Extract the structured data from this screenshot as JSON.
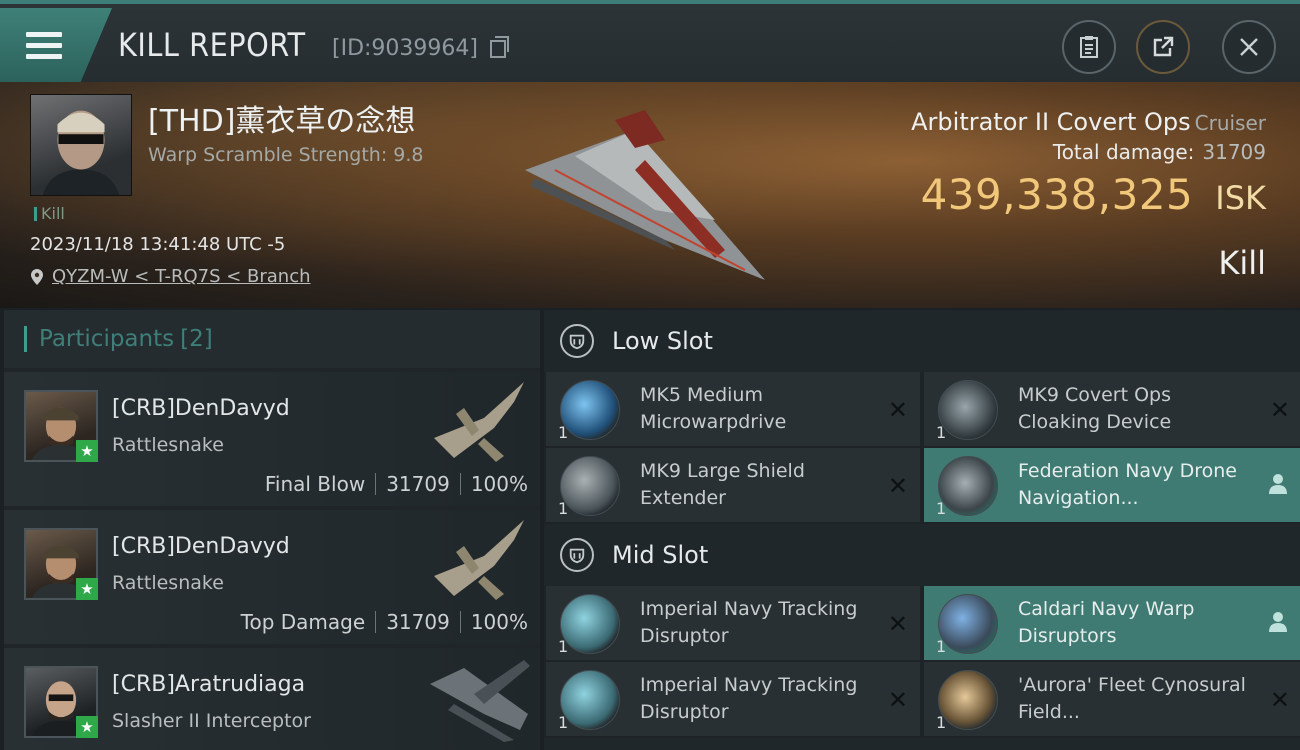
{
  "header": {
    "title": "KILL REPORT",
    "report_id": "[ID:9039964]"
  },
  "victim": {
    "name": "[THD]薰衣草の念想",
    "warp_scramble": "Warp Scramble Strength: 9.8",
    "kill_tag": "Kill",
    "datetime": "2023/11/18 13:41:48 UTC -5",
    "location": "QYZM-W < T-RQ7S < Branch",
    "ship": "Arbitrator II Covert Ops",
    "ship_class": "Cruiser",
    "total_damage_label": "Total damage:",
    "total_damage": "31709",
    "isk_value": "439,338,325",
    "isk_unit": "ISK",
    "result": "Kill"
  },
  "participants": {
    "header": "Participants",
    "count": "[2]",
    "rows": [
      {
        "name": "[CRB]DenDavyd",
        "ship": "Rattlesnake",
        "role": "Final Blow",
        "damage": "31709",
        "percent": "100%"
      },
      {
        "name": "[CRB]DenDavyd",
        "ship": "Rattlesnake",
        "role": "Top Damage",
        "damage": "31709",
        "percent": "100%"
      },
      {
        "name": "[CRB]Aratrudiaga",
        "ship": "Slasher II Interceptor",
        "role": "",
        "damage": "",
        "percent": ""
      }
    ]
  },
  "fitting": {
    "low_slot": {
      "title": "Low Slot",
      "modules": [
        {
          "name": "MK5 Medium Microwarpdrive",
          "qty": "1",
          "state": "destroyed",
          "icon": "microwarpdrive-icon"
        },
        {
          "name": "MK9 Covert Ops Cloaking Device",
          "qty": "1",
          "state": "destroyed",
          "icon": "cloaking-device-icon"
        },
        {
          "name": "MK9 Large Shield Extender",
          "qty": "1",
          "state": "destroyed",
          "icon": "shield-extender-icon"
        },
        {
          "name": "Federation Navy Drone Navigation...",
          "qty": "1",
          "state": "dropped",
          "icon": "drone-navigation-icon"
        }
      ]
    },
    "mid_slot": {
      "title": "Mid Slot",
      "modules": [
        {
          "name": "Imperial Navy Tracking Disruptor",
          "qty": "1",
          "state": "destroyed",
          "icon": "tracking-disruptor-icon"
        },
        {
          "name": "Caldari Navy Warp Disruptors",
          "qty": "1",
          "state": "dropped",
          "icon": "warp-disruptor-icon"
        },
        {
          "name": "Imperial Navy Tracking Disruptor",
          "qty": "1",
          "state": "destroyed",
          "icon": "tracking-disruptor-icon"
        },
        {
          "name": "'Aurora' Fleet Cynosural Field...",
          "qty": "1",
          "state": "destroyed",
          "icon": "cynosural-field-icon"
        }
      ]
    }
  },
  "colors": {
    "accent": "#3c9e8c",
    "isk_gold": "#f1c77a",
    "dropped_bg": "#3f7a73",
    "corp_star": "#2fa84a"
  }
}
